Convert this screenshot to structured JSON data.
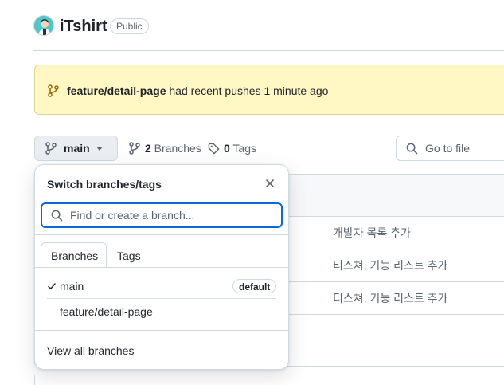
{
  "repo": {
    "name": "iTshirt",
    "visibility": "Public"
  },
  "banner": {
    "branch": "feature/detail-page",
    "message": " had recent pushes 1 minute ago"
  },
  "toolbar": {
    "current_branch": "main",
    "branches_count": "2",
    "branches_label": " Branches",
    "tags_count": "0",
    "tags_label": " Tags",
    "goto_file_placeholder": "Go to file"
  },
  "files": {
    "commit_messages": [
      "개발자 목록 추가",
      "티스쳐, 기능 리스트 추가",
      "티스쳐, 기능 리스트 추가"
    ]
  },
  "dropdown": {
    "title": "Switch branches/tags",
    "search_placeholder": "Find or create a branch...",
    "tabs": [
      "Branches",
      "Tags"
    ],
    "items": [
      {
        "name": "main",
        "badge": "default",
        "selected": true
      },
      {
        "name": "feature/detail-page",
        "badge": "",
        "selected": false
      }
    ],
    "view_all": "View all branches"
  },
  "colors": {
    "accent": "#0969da",
    "banner_bg": "#fff8c5",
    "border": "#d1d9e0",
    "muted_text": "#59636e"
  },
  "icons": {
    "branch": "git-branch-icon",
    "tag": "tag-icon",
    "search": "search-icon",
    "close": "close-icon",
    "check": "check-icon",
    "caret": "triangle-down-icon"
  }
}
